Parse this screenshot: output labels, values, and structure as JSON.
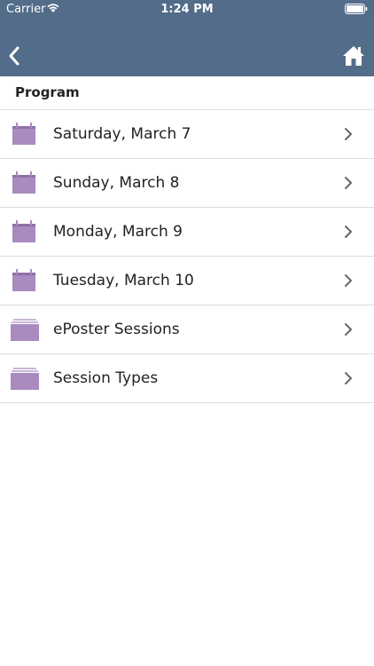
{
  "status_bar": {
    "carrier": "Carrier",
    "time": "1:24 PM"
  },
  "nav": {
    "back_icon": "chevron-left-icon",
    "home_icon": "home-icon"
  },
  "section": {
    "title": "Program"
  },
  "items": [
    {
      "label": "Saturday, March 7",
      "icon": "calendar-icon"
    },
    {
      "label": "Sunday, March 8",
      "icon": "calendar-icon"
    },
    {
      "label": "Monday, March 9",
      "icon": "calendar-icon"
    },
    {
      "label": "Tuesday, March 10",
      "icon": "calendar-icon"
    },
    {
      "label": "ePoster Sessions",
      "icon": "folder-stack-icon"
    },
    {
      "label": "Session Types",
      "icon": "folder-stack-icon"
    }
  ],
  "colors": {
    "header_bg": "#536c8a",
    "icon_purple": "#a98bbf",
    "divider": "#dddddd"
  }
}
